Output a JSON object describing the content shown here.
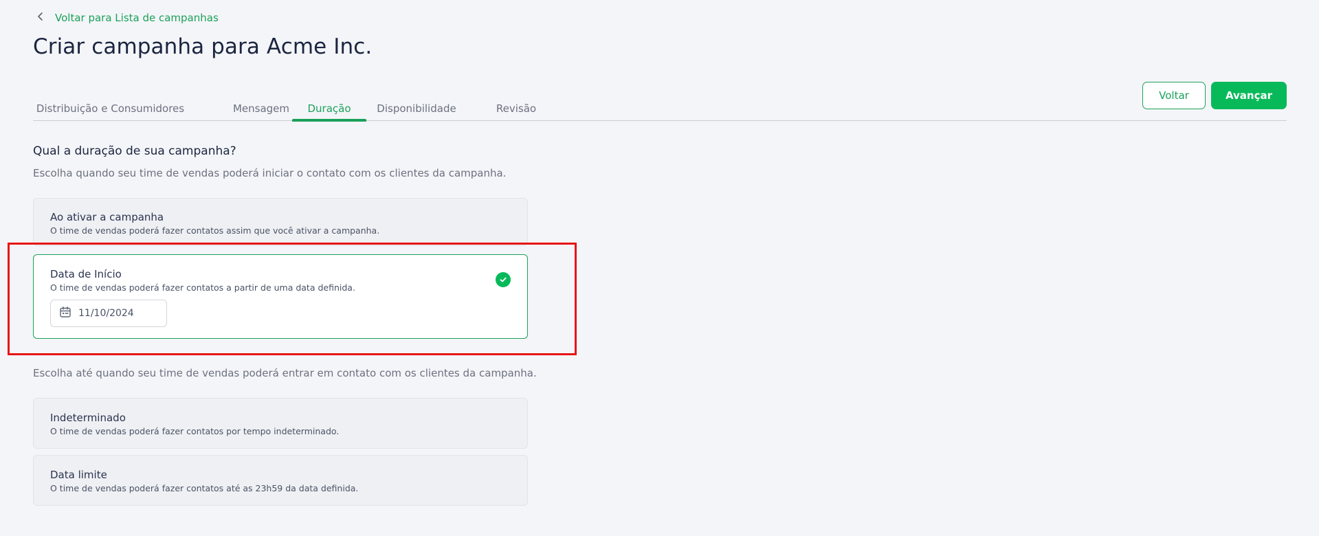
{
  "breadcrumb": {
    "label": "Voltar para Lista de campanhas"
  },
  "page": {
    "title": "Criar campanha para Acme Inc."
  },
  "tabs": [
    {
      "label": "Distribuição e Consumidores",
      "active": false
    },
    {
      "label": "Mensagem",
      "active": false
    },
    {
      "label": "Duração",
      "active": true
    },
    {
      "label": "Disponibilidade",
      "active": false
    },
    {
      "label": "Revisão",
      "active": false
    }
  ],
  "actions": {
    "back_label": "Voltar",
    "next_label": "Avançar"
  },
  "duration": {
    "question": "Qual a duração de sua campanha?",
    "start_hint": "Escolha quando seu time de vendas poderá iniciar o contato com os clientes da campanha.",
    "end_hint": "Escolha até quando seu time de vendas poderá entrar em contato com os clientes da campanha.",
    "start_options": [
      {
        "title": "Ao ativar a campanha",
        "description": "O time de vendas poderá fazer contatos assim que você ativar a campanha.",
        "selected": false
      },
      {
        "title": "Data de Início",
        "description": "O time de vendas poderá fazer contatos a partir de uma data definida.",
        "selected": true,
        "date_value": "11/10/2024"
      }
    ],
    "end_options": [
      {
        "title": "Indeterminado",
        "description": "O time de vendas poderá fazer contatos por tempo indeterminado.",
        "selected": false
      },
      {
        "title": "Data limite",
        "description": "O time de vendas poderá fazer contatos até as 23h59 da data definida.",
        "selected": false
      }
    ]
  },
  "colors": {
    "accent": "#1aa15a",
    "primary_button": "#08b95a",
    "highlight": "#e81414",
    "background": "#f4f5f8"
  },
  "icons": {
    "back": "chevron-left-icon",
    "selected": "check-circle-icon",
    "date": "calendar-icon"
  }
}
